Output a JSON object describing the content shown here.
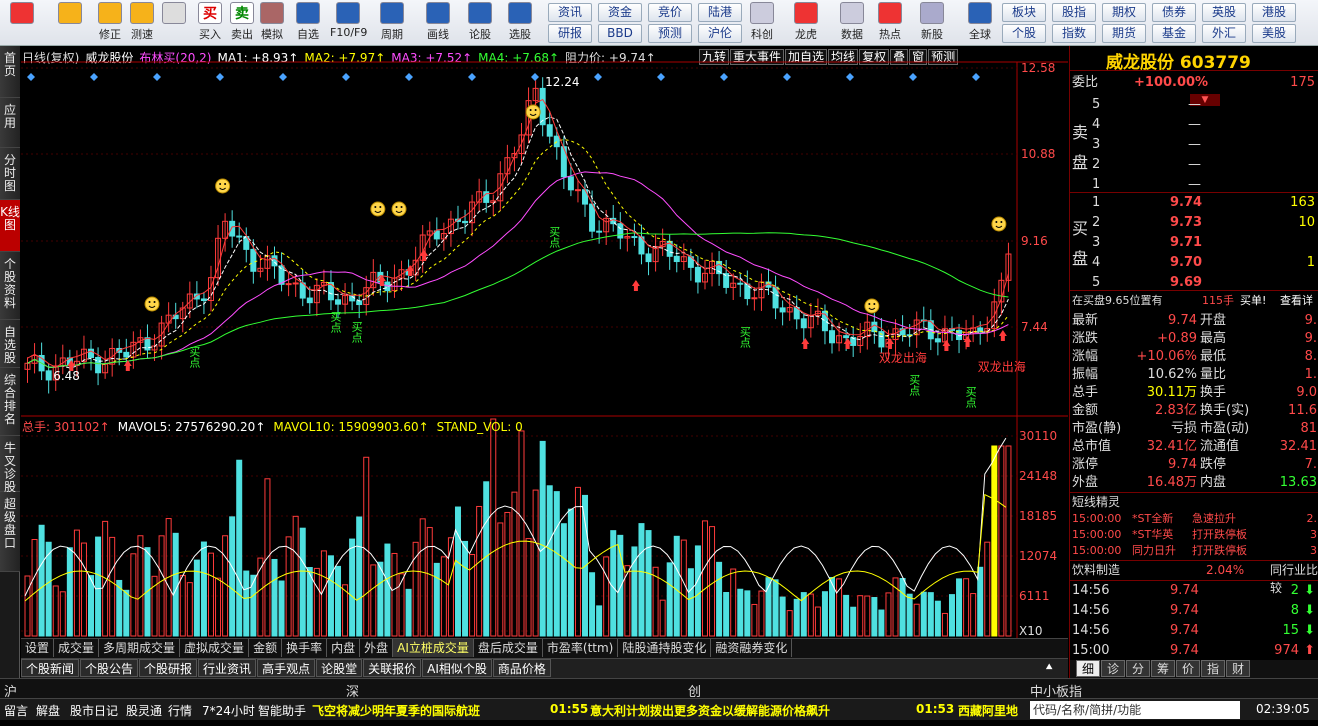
{
  "toolbar": {
    "big": [
      {
        "label": "",
        "icon": "app-menu-icon"
      },
      {
        "label": "",
        "icon": "back-icon"
      },
      {
        "label": "修正",
        "icon": "updown-icon"
      },
      {
        "label": "测速",
        "icon": "refresh-icon"
      },
      {
        "label": "",
        "icon": "clock-icon"
      },
      {
        "label": "买入",
        "icon": "buy-icon"
      },
      {
        "label": "卖出",
        "icon": "sell-icon"
      },
      {
        "label": "模拟",
        "icon": "gavel-icon"
      },
      {
        "label": "自选",
        "icon": "star-icon"
      },
      {
        "label": "F10/F9",
        "icon": "f10-icon"
      },
      {
        "label": "周期",
        "icon": "cycle-icon"
      },
      {
        "label": "画线",
        "icon": "pen-icon"
      },
      {
        "label": "论股",
        "icon": "chat-icon"
      },
      {
        "label": "选股",
        "icon": "select-icon"
      },
      {
        "label": "科创",
        "icon": "chart-icon"
      },
      {
        "label": "龙虎",
        "icon": "dragon-icon"
      },
      {
        "label": "数据",
        "icon": "pe-icon"
      },
      {
        "label": "热点",
        "icon": "hot-icon"
      },
      {
        "label": "新股",
        "icon": "ipo-icon"
      },
      {
        "label": "全球",
        "icon": "globe-icon"
      }
    ],
    "buttons_row1": [
      "资讯",
      "资金",
      "竞价",
      "陆港",
      "板块",
      "股指",
      "期权",
      "债券",
      "英股",
      "港股"
    ],
    "buttons_row2": [
      "研报",
      "BBD",
      "预测",
      "沪伦",
      "个股",
      "指数",
      "期货",
      "基金",
      "外汇",
      "美股"
    ]
  },
  "sidebar": [
    "首页",
    "应用",
    "分时图",
    "K线图",
    "个股资料",
    "自选股",
    "综合排名",
    "牛叉诊股",
    "超级盘口"
  ],
  "chart": {
    "title_items": [
      {
        "t": "日线(复权)",
        "c": "#ddd"
      },
      {
        "t": "威龙股份",
        "c": "#fff"
      },
      {
        "t": "布林买(20,2)",
        "c": "#ff4dff"
      },
      {
        "t": "MA1: +8.93↑",
        "c": "#fff"
      },
      {
        "t": "MA2: +7.97↑",
        "c": "#ff0"
      },
      {
        "t": "MA3: +7.52↑",
        "c": "#ff4dff"
      },
      {
        "t": "MA4: +7.68↑",
        "c": "#3f3"
      },
      {
        "t": "阻力价: +9.74↑",
        "c": "#ddd"
      }
    ],
    "ptools": [
      "九转",
      "重大事件",
      "加自选",
      "均线",
      "复权",
      "叠",
      "窗",
      "预测"
    ],
    "price_labels": [
      "12.58",
      "10.88",
      "9.16",
      "7.44"
    ],
    "high_label": "12.24",
    "low_label": "6.48",
    "annotations": [
      "双龙出海",
      "双龙出海"
    ],
    "buy_label": "买点",
    "vol_info": [
      {
        "t": "总手: 301102↑",
        "c": "#ff4a4a"
      },
      {
        "t": "MAVOL5: 27576290.20↑",
        "c": "#fff"
      },
      {
        "t": "MAVOL10: 15909903.60↑",
        "c": "#ff0"
      },
      {
        "t": "STAND_VOL: 0",
        "c": "#ff0"
      }
    ],
    "vol_labels": [
      "30110",
      "24148",
      "18185",
      "12074",
      "6111",
      "X10"
    ]
  },
  "bottom_tabs": [
    "设置",
    "成交量",
    "多周期成交量",
    "虚拟成交量",
    "金额",
    "换手率",
    "内盘",
    "外盘",
    "AI立桩成交量",
    "盘后成交量",
    "市盈率(ttm)",
    "陆股通持股变化",
    "融资融券变化"
  ],
  "news_tabs": [
    "个股新闻",
    "个股公告",
    "个股研报",
    "行业资讯",
    "高手观点",
    "论股堂",
    "关联报价",
    "AI相似个股",
    "商品价格"
  ],
  "right": {
    "name": "威龙股份 603779",
    "weibi_label": "委比",
    "weibi": "+100.00%",
    "weibi_num": "175",
    "sell": [
      {
        "n": "5",
        "p": "—"
      },
      {
        "n": "4",
        "p": "—"
      },
      {
        "n": "3",
        "p": "—"
      },
      {
        "n": "2",
        "p": "—"
      },
      {
        "n": "1",
        "p": "—"
      }
    ],
    "sell_label": "卖盘",
    "buy": [
      {
        "n": "1",
        "p": "9.74",
        "v": "163"
      },
      {
        "n": "2",
        "p": "9.73",
        "v": "10"
      },
      {
        "n": "3",
        "p": "9.71",
        "v": ""
      },
      {
        "n": "4",
        "p": "9.70",
        "v": "1"
      },
      {
        "n": "5",
        "p": "9.69",
        "v": ""
      }
    ],
    "buy_label": "买盘",
    "notice": "在买盘9.65位置有",
    "notice_v": "115手",
    "notice_b": "买单!",
    "notice_link": "查看详",
    "stats": [
      [
        "最新",
        "9.74",
        "开盘",
        "9."
      ],
      [
        "涨跌",
        "+0.89",
        "最高",
        "9."
      ],
      [
        "涨幅",
        "+10.06%",
        "最低",
        "8."
      ],
      [
        "振幅",
        "10.62%",
        "量比",
        "1."
      ],
      [
        "总手",
        "30.11万",
        "换手",
        "9.0"
      ],
      [
        "金额",
        "2.83亿",
        "换手(实)",
        "11.6"
      ],
      [
        "市盈(静)",
        "亏损",
        "市盈(动)",
        "81"
      ],
      [
        "总市值",
        "32.41亿",
        "流通值",
        "32.41"
      ],
      [
        "涨停",
        "9.74",
        "跌停",
        "7."
      ],
      [
        "外盘",
        "16.48万",
        "内盘",
        "13.63"
      ]
    ],
    "shortline": "短线精灵",
    "sl_rows": [
      [
        "15:00:00",
        "*ST全新",
        "急速拉升",
        "2."
      ],
      [
        "15:00:00",
        "*ST华英",
        "打开跌停板",
        "3"
      ],
      [
        "15:00:00",
        "同力日升",
        "打开跌停板",
        "3"
      ]
    ],
    "industry": "饮料制造",
    "industry_pct": "2.04%",
    "industry_link": "同行业比较",
    "ticks": [
      [
        "14:56",
        "9.74",
        "2"
      ],
      [
        "14:56",
        "9.74",
        "8"
      ],
      [
        "14:56",
        "9.74",
        "15"
      ],
      [
        "15:00",
        "9.74",
        "974"
      ]
    ],
    "tabs": [
      "细",
      "诊",
      "分",
      "筹",
      "价",
      "指",
      "财"
    ]
  },
  "status": {
    "markets": [
      "沪",
      "深",
      "创",
      "中小板指"
    ],
    "items": [
      "留言",
      "解盘",
      "股市日记",
      "股灵通",
      "行情",
      "7*24小时",
      "智能助手"
    ],
    "news1": "飞空将减少明年夏季的国际航班",
    "news2_time": "01:55",
    "news2": "意大利计划拨出更多资金以缓解能源价格飙升",
    "news3_time": "01:53",
    "news3": "西藏阿里地",
    "search": "代码/名称/简拼/功能",
    "clock": "02:39:05"
  }
}
